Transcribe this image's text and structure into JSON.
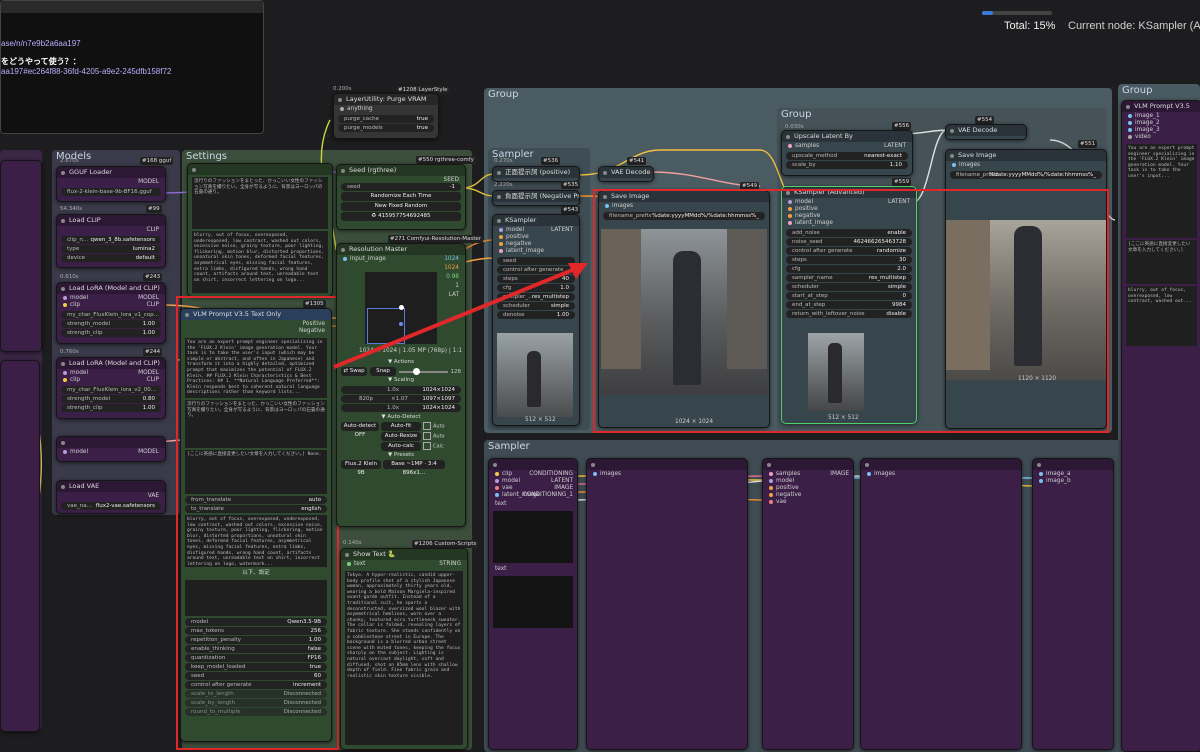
{
  "status": {
    "progress_percent": 15,
    "total_label": "Total: 15%",
    "current_node_label": "Current node: KSampler (Ac"
  },
  "info_panel": {
    "line1": "ase/n/n7e9b2a6aa197",
    "line2": "をどうやって使う？：",
    "line3": "aa197#ec264f88-36fd-4205-a9e2-245dfb158f72"
  },
  "groups": {
    "models": "Models",
    "settings": "Settings",
    "group_top": "Group",
    "group_inner": "Group",
    "group_right": "Group",
    "sampler_top": "Sampler",
    "sampler_bottom": "Sampler"
  },
  "nodes": {
    "gguf_loader": {
      "title": "GGUF Loader",
      "time": "2.670s",
      "id": "#168 gguf",
      "out": "MODEL",
      "file": "flux-2-klein-base-9b-BF16.gguf"
    },
    "load_clip": {
      "title": "Load CLIP",
      "time": "54.340s",
      "id": "#99",
      "out": "CLIP",
      "clip_name": "clip_n…",
      "clip_val": "qwen_3_8b.safetensors",
      "type": "type",
      "type_val": "lumina2",
      "device": "device",
      "device_val": "default"
    },
    "lora1": {
      "title": "Load LoRA (Model and CLIP)",
      "time": "0.610s",
      "id": "#243",
      "in_model": "model",
      "in_clip": "clip",
      "out_model": "MODEL",
      "out_clip": "CLIP",
      "lora": "my_char_FluxKlein_lora_v1_cop…",
      "strength_model": "strength_model",
      "sm_val": "1.00",
      "strength_clip": "strength_clip",
      "sc_val": "1.00"
    },
    "lora2": {
      "title": "Load LoRA (Model and CLIP)",
      "time": "0.760s",
      "id": "#244",
      "lora": "my_char_FluxKlein_lora_v2_00…",
      "sm_val": "0.80",
      "sc_val": "1.00"
    },
    "model_out": {
      "in": "model",
      "out": "MODEL"
    },
    "load_vae": {
      "title": "Load VAE",
      "out": "VAE",
      "file_label": "vae_na…",
      "file": "flux2-vae.safetensors"
    },
    "purge_vram": {
      "title": "LayerUtility: Purge VRAM",
      "time": "0.200s",
      "id": "#1208 LayerStyle",
      "anything": "anything",
      "purge_cache": "purge_cache",
      "purge_cache_val": "true",
      "purge_models": "purge_models",
      "purge_models_val": "true"
    },
    "seed": {
      "title": "Seed (rgthree)",
      "id": "#550 rgthree-comfy",
      "out": "SEED",
      "seed_label": "seed",
      "seed_val": "-1",
      "btn1": "Randomize Each Time",
      "btn2": "New Fixed Random",
      "last": "♻ 415957754692485"
    },
    "resolution": {
      "title": "Resolution Master",
      "id": "#271 Comfyui-Resolution-Master",
      "in": "input_image",
      "w": "1024",
      "h": "1024",
      "ratio": "0.98",
      "batch": "1",
      "lat": "LAT",
      "info": "1024 × 1024 | 1.05 MP (768p) | 1:1",
      "actions": "▼ Actions",
      "swap": "⇄ Swap",
      "snap": "Snap",
      "snap_val": "128",
      "scaling": "▼ Scaling",
      "scale_vals": [
        "1.0x",
        "×1.07",
        "1.0x"
      ],
      "scale_res": [
        "1024×1024",
        "1097×1097",
        "1024×1024"
      ],
      "res_select": "820p",
      "auto_detect": "▼ Auto-Detect",
      "auto_off": "Auto-detect OFF",
      "auto_fit": "Auto-fit",
      "auto": "Auto",
      "auto_resize": "Auto-Resize",
      "auto_calc": "Auto-calc",
      "calc": "Calc",
      "presets": "▼ Presets",
      "preset1": "Flux.2 Klein 9B",
      "preset2": "Base ~1MP · 3:4 896x1…"
    },
    "vlm": {
      "title": "VLM Prompt V3.5 Text Only",
      "id": "#1305",
      "out1": "Positive",
      "out2": "Negative",
      "text1": "You are an expert prompt engineer specializing in the 'FLUX.2 Klein' image generation model. Your task is to take the user's input (which may be simple or abstract, and often in Japanese) and transform it into a highly detailed, optimized prompt that maximizes the potential of FLUX.2 Klein. ## FLUX.2 Klein Characteristics & Best Practices: ## 1. **Natural Language Preferred**: Klein responds best to coherent natural language descriptions rather than keyword lists...",
      "text2": "流行りのファッションをまとった、かっこいい女性のファッション写真を撮りたい。全身が写るように、背景はヨーロッパの石畳の通り。",
      "text3": "[ここに英語に直接変更したい文章を入力してください。] None.",
      "from_translate": "from_translate",
      "from_val": "auto",
      "to_translate": "to_translate",
      "to_val": "english",
      "text4": "blurry, out of focus, overexposed, underexposed, low contrast, washed out colors, excessive noise, grainy texture, poor lighting, flickering, motion blur, distorted proportions, unnatural skin tones, deformed facial features, asymmetrical eyes, missing facial features, extra limbs, disfigured hands, wrong hand count, artifacts around text, unreadable text on shirt, incorrect lettering on logo, watermark...",
      "divider": "以下、設定",
      "model": "model",
      "model_val": "Qwen3.5-9B",
      "max_tokens": "max_tokens",
      "max_tokens_val": "256",
      "rep": "repetition_penalty",
      "rep_val": "1.00",
      "thinking": "enable_thinking",
      "thinking_val": "false",
      "quant": "quantization",
      "quant_val": "FP16",
      "keep": "keep_model_loaded",
      "keep_val": "true",
      "seed": "seed",
      "seed_val": "60",
      "cag": "control after generate",
      "cag_val": "increment",
      "scale1": "scale_to_length",
      "scale1_val": "Disconnected",
      "scale2": "scale_by_length",
      "scale2_val": "Disconnected",
      "scale3": "round_to_multiple",
      "scale3_val": "Disconnected"
    },
    "settings_text": {
      "text1": "流行りのファッションをまとった、かっこいい女性のファッション写真を撮りたい。全身が写るように、背景はヨーロッパの石畳の通り。",
      "text2": "blurry, out of focus, overexposed, underexposed, low contrast, washed out colors, excessive noise, grainy texture, poor lighting, flickering, motion blur, distorted proportions, unnatural skin tones, deformed facial features, asymmetrical eyes, missing facial features, extra limbs, disfigured hands, wrong hand count, artifacts around text, unreadable text on shirt, incorrect lettering on logo..."
    },
    "show_text": {
      "title": "Show Text 🐍",
      "time": "0.140s",
      "id": "#1206 Custom-Scripts",
      "in": "text",
      "out": "STRING",
      "body": "Tokyo. A hyper-realistic, candid upper-body profile shot of a stylish Japanese woman, approximately thirty years old, wearing a bold Maison Margiela-inspired avant-garde outfit. Instead of a traditional suit, he sports a deconstructed, oversized wool blazer with asymmetrical hemlines, worn over a chunky, textured ecru turtleneck sweater. The collar is folded, revealing layers of fabric texture. She stands confidently on a cobblestone street in Europe. The background is a blurred urban street scene with muted tones, keeping the focus sharply on the subject. Lighting is natural overcast daylight, soft and diffused, shot on 85mm lens with shallow depth of field. Fine fabric grain and realistic skin texture visible."
    },
    "pos_prompt": {
      "title": "正面提示詞 (positive)",
      "time": "0.270s",
      "id": "#536"
    },
    "neg_prompt": {
      "title": "負面提示詞 (Negative Prom",
      "time": "2.220s",
      "id": "#535"
    },
    "ksampler_a": {
      "title": "KSampler",
      "id": "#543",
      "in": [
        "model",
        "positive",
        "negative",
        "latent_image"
      ],
      "out": "LATENT",
      "widgets": [
        [
          "seed",
          ""
        ],
        [
          "control after generate",
          ""
        ],
        [
          "steps",
          "40"
        ],
        [
          "cfg",
          "1.0"
        ],
        [
          "sampler_…",
          "res_multistep"
        ],
        [
          "scheduler",
          "simple"
        ],
        [
          "denoise",
          "1.00"
        ]
      ],
      "preview_caption": "512 × 512"
    },
    "vae_decode_a": {
      "title": "VAE Decode",
      "id": "#541"
    },
    "save_image": {
      "title": "Save Image",
      "id": "#549",
      "in": "images",
      "prefix_label": "filename_prefix",
      "prefix_val": "%date:yyyyMMdd%/%date:hhmmss%_",
      "caption": "1024 × 1024"
    },
    "upscale": {
      "title": "Upscale Latent By",
      "time": "0.030s",
      "id": "#556",
      "in": "samples",
      "out": "LATENT",
      "method": "upscale_method",
      "method_val": "nearest-exact",
      "scale": "scale_by",
      "scale_val": "1.10"
    },
    "ksampler_adv": {
      "title": "KSampler (Advanced)",
      "id": "#559",
      "in": [
        "model",
        "positive",
        "negative",
        "latent_image"
      ],
      "out": "LATENT",
      "widgets": [
        [
          "add_noise",
          "enable"
        ],
        [
          "noise_seed",
          "462466265463728"
        ],
        [
          "control after generate",
          "randomize"
        ],
        [
          "steps",
          "30"
        ],
        [
          "cfg",
          "2.0"
        ],
        [
          "sampler_name",
          "res_multistep"
        ],
        [
          "scheduler",
          "simple"
        ],
        [
          "start_at_step",
          "0"
        ],
        [
          "end_at_step",
          "9984"
        ],
        [
          "return_with_leftover_noise",
          "disable"
        ]
      ],
      "preview_caption": "512 × 512"
    },
    "vae_decode_b": {
      "title": "VAE Decode",
      "id": "#554"
    },
    "save_image_b": {
      "title": "Save Image",
      "id": "#551",
      "in": "images",
      "prefix_label": "filename_prefix",
      "prefix_val": "%date:yyyyMMdd%/%date:hhmmss%_",
      "caption": "1120 × 1120"
    },
    "right_panel": {
      "title": "VLM Prompt V3.5",
      "ins": [
        "image_1",
        "image_2",
        "image_3",
        "video"
      ],
      "text1": "You are an expert prompt engineer specializing in the 'FLUX.2 Klein' image generation model. Your task is to take the user's input...",
      "text2": "[ここに英語に直接変更したい文章を入力してください。]",
      "text3": "blurry, out of focus, overexposed, low contrast, washed out..."
    },
    "bottom": {
      "in1": [
        "clip",
        "model",
        "vae",
        "latent_image"
      ],
      "out1": [
        "CONDITIONING",
        "LATENT",
        "IMAGE",
        "CONDITIONING_1"
      ],
      "in2": [
        "samples",
        "model",
        "positive",
        "negative",
        "vae"
      ],
      "out2": "IMAGE",
      "in3": "images",
      "out4": [
        "image_a",
        "image_b"
      ],
      "labels": [
        "text",
        "text"
      ]
    }
  },
  "left_panel": {
    "string_label": "string",
    "label_a": "model",
    "label_b": "MODEL"
  }
}
